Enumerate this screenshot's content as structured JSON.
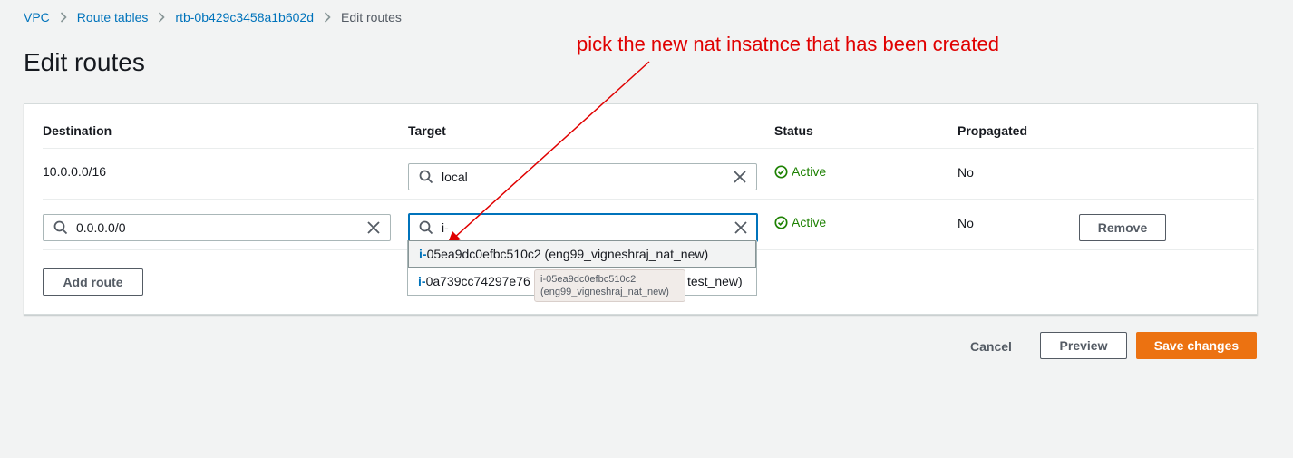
{
  "breadcrumb": {
    "items": [
      "VPC",
      "Route tables",
      "rtb-0b429c3458a1b602d"
    ],
    "current": "Edit routes"
  },
  "page_title": "Edit routes",
  "annotation": {
    "text": "pick the new nat insatnce that has been created",
    "color": "#e00000"
  },
  "table": {
    "headers": {
      "destination": "Destination",
      "target": "Target",
      "status": "Status",
      "propagated": "Propagated"
    },
    "rows": [
      {
        "destination": "10.0.0.0/16",
        "target_value": "local",
        "status": "Active",
        "propagated": "No"
      },
      {
        "destination_value": "0.0.0.0/0",
        "target_value": "i-",
        "status": "Active",
        "propagated": "No",
        "remove_label": "Remove"
      }
    ],
    "add_route_label": "Add route"
  },
  "dropdown": {
    "match_prefix": "i-",
    "options": [
      {
        "rest": "05ea9dc0efbc510c2 (eng99_vigneshraj_nat_new)"
      },
      {
        "rest": "0a739cc74297e76",
        "suffix": "test_new)"
      }
    ]
  },
  "tooltip": {
    "line1": "i-05ea9dc0efbc510c2",
    "line2": "(eng99_vigneshraj_nat_new)"
  },
  "actions": {
    "cancel": "Cancel",
    "preview": "Preview",
    "save": "Save changes"
  },
  "colors": {
    "link": "#0073bb",
    "primary": "#ec7211",
    "status_active": "#1d8102",
    "focus": "#0073bb"
  }
}
